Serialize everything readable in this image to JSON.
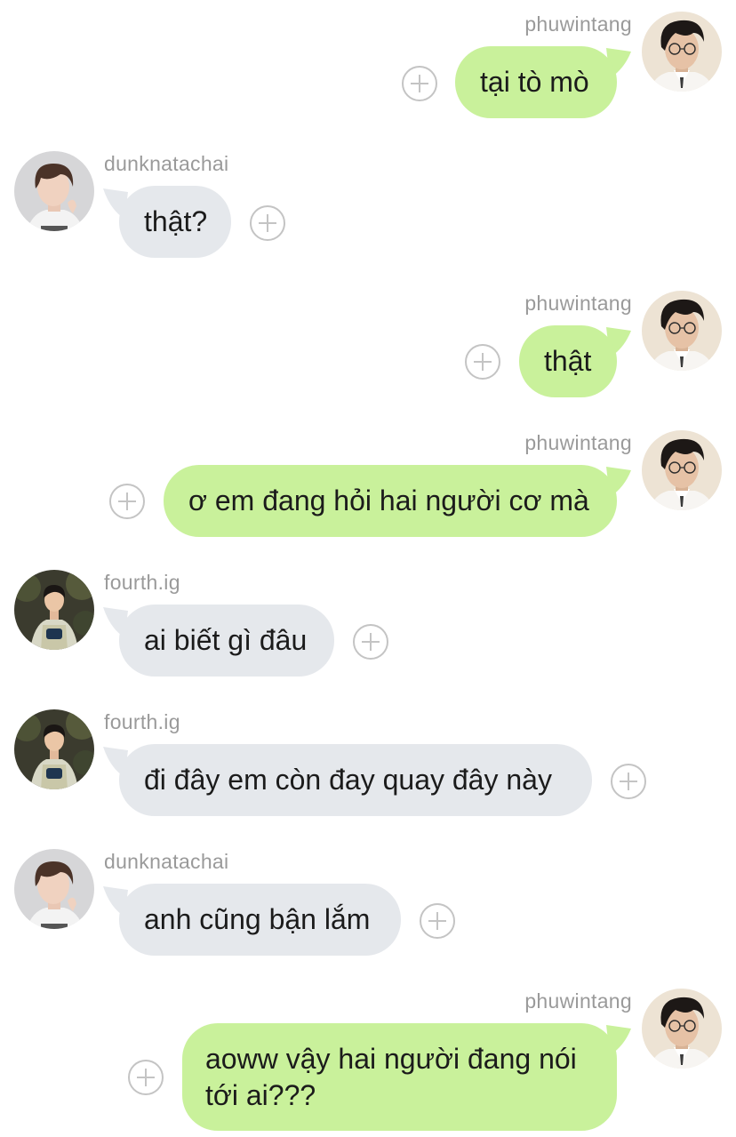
{
  "users": {
    "phuwintang": {
      "name": "phuwintang"
    },
    "dunknatachai": {
      "name": "dunknatachai"
    },
    "fourth": {
      "name": "fourth.ig"
    }
  },
  "colors": {
    "outgoing_bubble": "#c9f19b",
    "incoming_bubble": "#e5e8ec",
    "username": "#9a9a9a",
    "add_reaction_icon": "#c4c4c4"
  },
  "messages": [
    {
      "sender": "phuwintang",
      "direction": "outgoing",
      "text": "tại tò mò"
    },
    {
      "sender": "dunknatachai",
      "direction": "incoming",
      "text": "thật?"
    },
    {
      "sender": "phuwintang",
      "direction": "outgoing",
      "text": "thật"
    },
    {
      "sender": "phuwintang",
      "direction": "outgoing",
      "text": "ơ em đang hỏi hai người cơ mà"
    },
    {
      "sender": "fourth.ig",
      "direction": "incoming",
      "text": "ai biết gì đâu"
    },
    {
      "sender": "fourth.ig",
      "direction": "incoming",
      "text": "đi đây em còn đay quay đây này"
    },
    {
      "sender": "dunknatachai",
      "direction": "incoming",
      "text": "anh cũng bận lắm"
    },
    {
      "sender": "phuwintang",
      "direction": "outgoing",
      "text": "aoww vậy hai người đang nói tới ai???"
    }
  ]
}
